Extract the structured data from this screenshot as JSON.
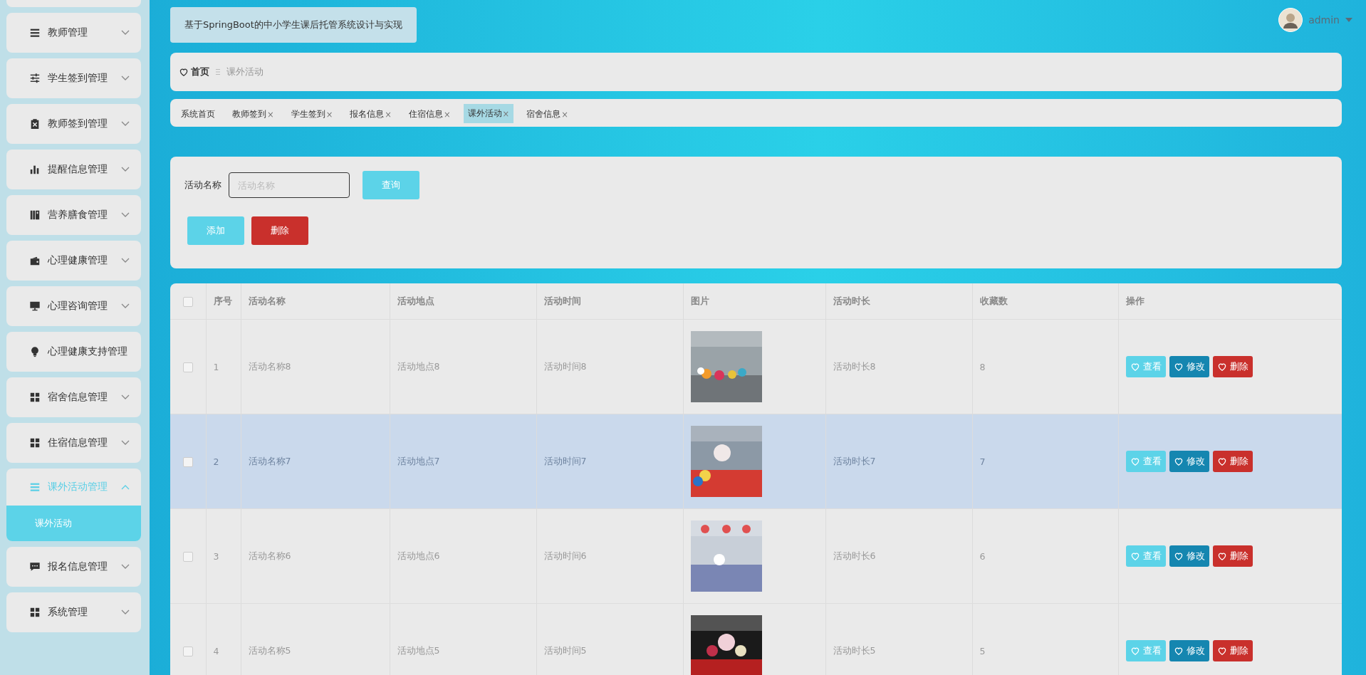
{
  "sidebar": {
    "items": [
      {
        "label": "教师管理",
        "expanded": false
      },
      {
        "label": "学生签到管理",
        "expanded": false
      },
      {
        "label": "教师签到管理",
        "expanded": false
      },
      {
        "label": "提醒信息管理",
        "expanded": false
      },
      {
        "label": "营养膳食管理",
        "expanded": false
      },
      {
        "label": "心理健康管理",
        "expanded": false
      },
      {
        "label": "心理咨询管理",
        "expanded": false
      },
      {
        "label": "心理健康支持管理"
      },
      {
        "label": "宿舍信息管理",
        "expanded": false
      },
      {
        "label": "住宿信息管理",
        "expanded": false
      },
      {
        "label": "课外活动管理",
        "expanded": true,
        "children": [
          {
            "label": "课外活动",
            "selected": true
          }
        ]
      },
      {
        "label": "报名信息管理",
        "expanded": false
      },
      {
        "label": "系统管理",
        "expanded": false
      }
    ]
  },
  "header": {
    "title": "基于SpringBoot的中小学生课后托管系统设计与实现",
    "user": "admin"
  },
  "breadcrumb": [
    "首页",
    "课外活动"
  ],
  "tabs": [
    {
      "label": "系统首页",
      "selected": false
    },
    {
      "label": "教师签到",
      "close": "×",
      "selected": false
    },
    {
      "label": "学生签到",
      "close": "×",
      "selected": false
    },
    {
      "label": "报名信息",
      "close": "×",
      "selected": false
    },
    {
      "label": "住宿信息",
      "close": "×",
      "selected": false
    },
    {
      "label": "课外活动",
      "close": "×",
      "selected": true
    },
    {
      "label": "宿舍信息",
      "close": "×",
      "selected": false
    }
  ],
  "search": {
    "label": "活动名称",
    "placeholder": "活动名称",
    "button": "查询"
  },
  "actions": [
    "添加",
    "删除"
  ],
  "table": {
    "select_all_checked": false,
    "columns": [
      "序号",
      "活动名称",
      "活动地点",
      "活动时间",
      "图片",
      "活动时长",
      "收藏数",
      "操作"
    ],
    "rows": [
      {
        "index": "1",
        "name": "活动名称8",
        "place": "活动地点8",
        "time": "活动时间8",
        "duration": "活动时长8",
        "favorites": "8",
        "checked": false,
        "highlighted": false,
        "buttons": [
          "查看",
          "修改",
          "删除"
        ]
      },
      {
        "index": "2",
        "name": "活动名称7",
        "place": "活动地点7",
        "time": "活动时间7",
        "duration": "活动时长7",
        "favorites": "7",
        "checked": false,
        "highlighted": true,
        "buttons": [
          "查看",
          "修改",
          "删除"
        ]
      },
      {
        "index": "3",
        "name": "活动名称6",
        "place": "活动地点6",
        "time": "活动时间6",
        "duration": "活动时长6",
        "favorites": "6",
        "checked": false,
        "highlighted": false,
        "buttons": [
          "查看",
          "修改",
          "删除"
        ]
      },
      {
        "index": "4",
        "name": "活动名称5",
        "place": "活动地点5",
        "time": "活动时间5",
        "duration": "活动时长5",
        "favorites": "5",
        "checked": false,
        "highlighted": false,
        "buttons": [
          "查看",
          "修改",
          "删除"
        ]
      }
    ]
  }
}
